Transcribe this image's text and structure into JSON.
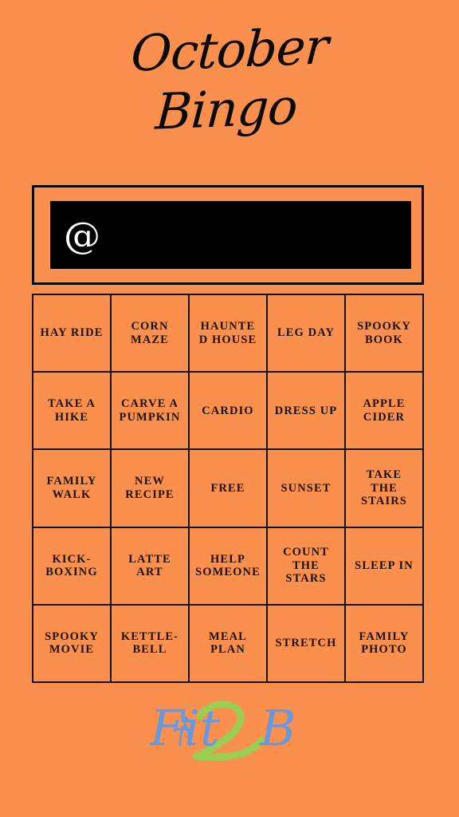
{
  "theme": {
    "background": "#fb8f4e",
    "ink": "#0a0a0a",
    "field_bg": "#000000",
    "field_text": "#ffffff",
    "logo_blue": "#6699dd",
    "logo_green": "#9acd52"
  },
  "title": {
    "line1": "October",
    "line2": "Bingo",
    "full": "October Bingo"
  },
  "handle": {
    "at_symbol": "@",
    "value": "",
    "placeholder": ""
  },
  "grid": {
    "columns": 5,
    "rows": 5,
    "free_space": "FREE",
    "cells": [
      "HAY RIDE",
      "CORN\nMAZE",
      "HAUNTE\nD HOUSE",
      "LEG DAY",
      "SPOOKY\nBOOK",
      "TAKE A\nHIKE",
      "CARVE A\nPUMPKIN",
      "CARDIO",
      "DRESS UP",
      "APPLE\nCIDER",
      "FAMILY\nWALK",
      "NEW\nRECIPE",
      "FREE",
      "SUNSET",
      "TAKE\nTHE\nSTAIRS",
      "KICK-\nBOXING",
      "LATTE\nART",
      "HELP\nSOMEONE",
      "COUNT\nTHE\nSTARS",
      "SLEEP IN",
      "SPOOKY\nMOVIE",
      "KETTLE-\nBELL",
      "MEAL\nPLAN",
      "STRETCH",
      "FAMILY\nPHOTO"
    ]
  },
  "logo": {
    "name": "Fit2B",
    "part_fit": "Fit",
    "part_two": "2",
    "part_b": "B"
  }
}
